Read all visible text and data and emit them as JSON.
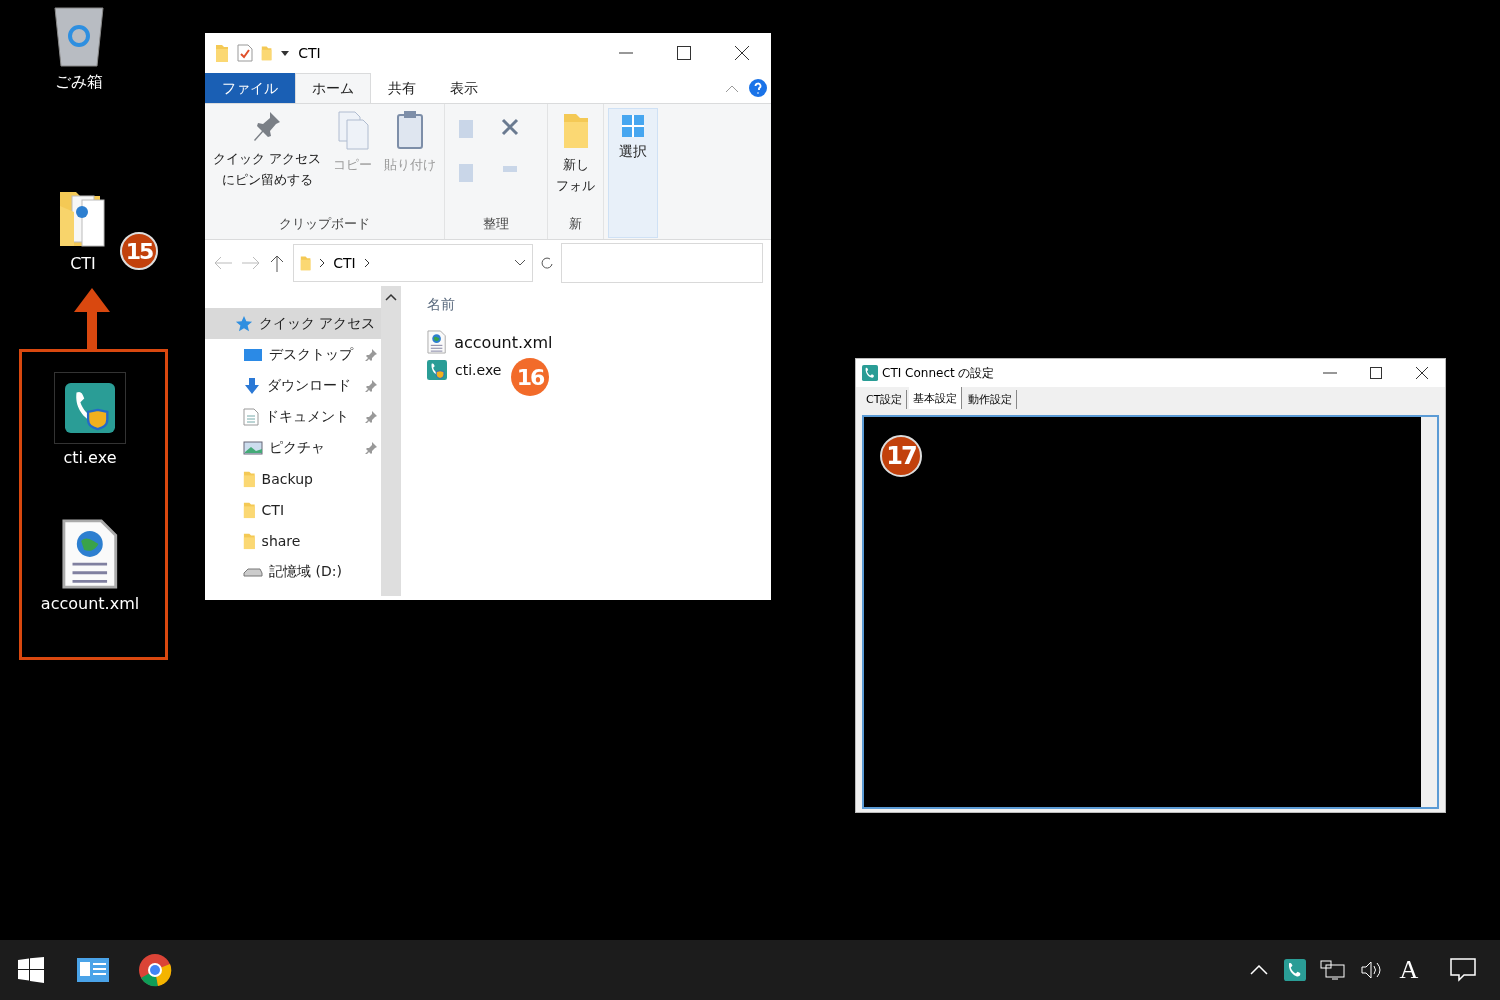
{
  "desktop": {
    "icons": [
      {
        "label": "ごみ箱",
        "kind": "recycle"
      },
      {
        "label": "CTI",
        "kind": "folder"
      }
    ],
    "step_badge": "15",
    "highlighted_files": [
      {
        "label": "cti.exe",
        "kind": "app"
      },
      {
        "label": "account.xml",
        "kind": "xml"
      }
    ]
  },
  "explorer": {
    "title": "CTI",
    "ribbon_tabs": [
      {
        "label": "ファイル",
        "kind": "file",
        "selected": false
      },
      {
        "label": "ホーム",
        "kind": "tab",
        "selected": true
      },
      {
        "label": "共有",
        "kind": "tab",
        "selected": false
      },
      {
        "label": "表示",
        "kind": "tab",
        "selected": false
      }
    ],
    "ribbon_groups": [
      {
        "label": "クリップボード",
        "buttons": [
          {
            "lines": [
              "クイック アクセス",
              "にピン留めする"
            ],
            "kind": "pin",
            "disabled": false
          },
          {
            "lines": [
              "コピー"
            ],
            "kind": "copy",
            "disabled": true
          },
          {
            "lines": [
              "貼り付け"
            ],
            "kind": "paste",
            "disabled": true
          }
        ]
      },
      {
        "label": "整理"
      },
      {
        "label": "新",
        "buttons": [
          {
            "lines": [
              "新し",
              "フォル"
            ],
            "kind": "folder",
            "disabled": false
          }
        ]
      }
    ],
    "select_button": "選択",
    "address": "CTI",
    "nav_items": [
      {
        "label": "クイック アクセス",
        "kind": "star",
        "pinned": false,
        "selected": true
      },
      {
        "label": "デスクトップ",
        "kind": "desktop",
        "pinned": true,
        "selected": false
      },
      {
        "label": "ダウンロード",
        "kind": "download",
        "pinned": true,
        "selected": false
      },
      {
        "label": "ドキュメント",
        "kind": "document",
        "pinned": true,
        "selected": false
      },
      {
        "label": "ピクチャ",
        "kind": "picture",
        "pinned": true,
        "selected": false
      },
      {
        "label": "Backup",
        "kind": "folder",
        "pinned": false,
        "selected": false
      },
      {
        "label": "CTI",
        "kind": "folder",
        "pinned": false,
        "selected": false
      },
      {
        "label": "share",
        "kind": "folder",
        "pinned": false,
        "selected": false
      },
      {
        "label": "記憶域 (D:)",
        "kind": "drive",
        "pinned": false,
        "selected": false
      }
    ],
    "column_header": "名前",
    "files": [
      {
        "name": "account.xml",
        "kind": "xml"
      },
      {
        "name": "cti.exe",
        "kind": "app"
      }
    ],
    "step_badge": "16"
  },
  "settings_window": {
    "title": "CTI Connect の設定",
    "tabs": [
      {
        "label": "CT設定",
        "selected": false
      },
      {
        "label": "基本設定",
        "selected": true
      },
      {
        "label": "動作設定",
        "selected": false
      }
    ],
    "step_badge": "17"
  },
  "taskbar": {
    "ime": "A"
  }
}
